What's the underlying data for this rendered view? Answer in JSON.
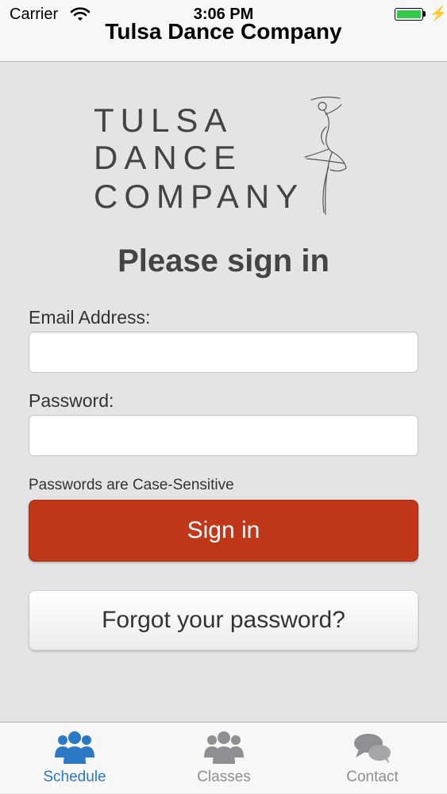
{
  "status_bar": {
    "carrier": "Carrier",
    "time": "3:06 PM"
  },
  "nav": {
    "title": "Tulsa Dance Company"
  },
  "logo": {
    "lines": [
      "TULSA",
      "DANCE",
      "COMPANY"
    ]
  },
  "form": {
    "heading": "Please sign in",
    "email_label": "Email Address:",
    "email_value": "",
    "password_label": "Password:",
    "password_value": "",
    "hint": "Passwords are Case-Sensitive",
    "sign_in_label": "Sign in",
    "forgot_label": "Forgot your password?"
  },
  "tabs": [
    {
      "label": "Schedule",
      "icon": "group-icon",
      "active": true
    },
    {
      "label": "Classes",
      "icon": "group-icon",
      "active": false
    },
    {
      "label": "Contact",
      "icon": "chat-bubbles-icon",
      "active": false
    }
  ],
  "colors": {
    "accent": "#2a78c6",
    "primary_button": "#c13719",
    "battery": "#33c948",
    "inactive": "#8e8e93"
  }
}
